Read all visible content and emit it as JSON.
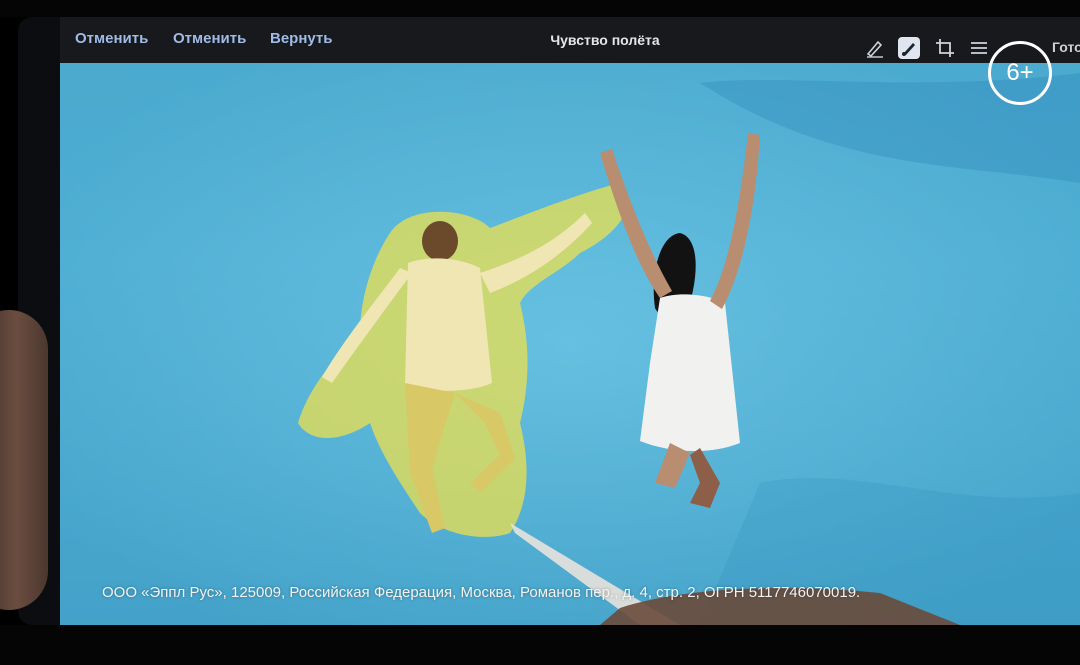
{
  "toolbar": {
    "undo_label_1": "Отменить",
    "undo_label_2": "Отменить",
    "redo_label": "Вернуть",
    "title": "Чувство полёта",
    "done_label": "Гото",
    "icons": [
      "markup-pen-icon",
      "brush-icon",
      "crop-icon",
      "adjust-sliders-icon"
    ]
  },
  "overlay": {
    "age_rating": "6+",
    "legal_text": "ООО «Эппл Рус», 125009, Российская Федерация, Москва, Романов пер., д. 4, стр. 2, ОГРН 5117746070019."
  },
  "colors": {
    "toolbar_bg": "#17191d",
    "toolbar_button": "#9fbbe6",
    "selection_highlight": "#f2e24a",
    "water": "#5ab7d8"
  }
}
